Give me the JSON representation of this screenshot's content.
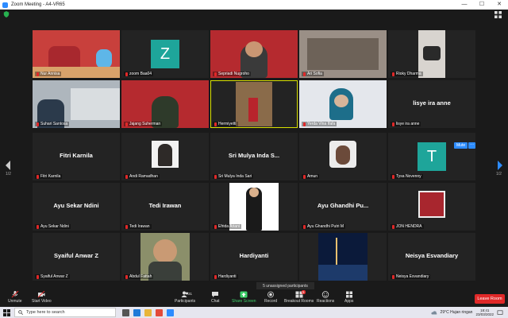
{
  "window": {
    "title": "Zoom Meeting - A4-VR65",
    "min": "—",
    "max": "☐",
    "close": "✕"
  },
  "pages": {
    "left": "1/2",
    "right": "1/2"
  },
  "tiles": [
    {
      "name": "Nur Annisa"
    },
    {
      "name": "zoom Baa04",
      "letter": "Z"
    },
    {
      "name": "Sepriadi Nugroho"
    },
    {
      "name": "Ari Sofia"
    },
    {
      "name": "Rioky Dharma"
    },
    {
      "name": "Suhari Santosa"
    },
    {
      "name": "Jajang Suherman"
    },
    {
      "name": "Hermiyetti"
    },
    {
      "name": "Yerda Vina Ifafa"
    },
    {
      "name": "lisye ira anne",
      "big": "lisye ira anne"
    },
    {
      "name": "Fitri Karnila",
      "big": "Fitri Karnila"
    },
    {
      "name": "Andi Ramadhan"
    },
    {
      "name": "Sri Mulya Inda Sari",
      "big": "Sri Mulya Inda S..."
    },
    {
      "name": "Amun"
    },
    {
      "name": "Tysa Novenny",
      "letter": "T"
    },
    {
      "name": "Ayu Sekar Ndini",
      "big": "Ayu Sekar Ndini"
    },
    {
      "name": "Tedi Irawan",
      "big": "Tedi Irawan"
    },
    {
      "name": "Efrida Ariani"
    },
    {
      "name": "Ayu Ghandhi Putri M",
      "big": "Ayu Ghandhi Pu..."
    },
    {
      "name": "JON HENDRA"
    },
    {
      "name": "Syaiful Anwar Z",
      "big": "Syaiful Anwar Z"
    },
    {
      "name": "Abdul Fattah"
    },
    {
      "name": "Hardiyanti",
      "big": "Hardiyanti"
    },
    {
      "name": ""
    },
    {
      "name": "Neisya Esvandiary",
      "big": "Neisya Esvandiary"
    }
  ],
  "mute_label": "Mute",
  "more_label": "···",
  "tooltip": "5 unassigned participants",
  "toolbar": {
    "unmute": "Unmute",
    "start_video": "Start Video",
    "participants": "Participants",
    "participants_count": "31",
    "chat": "Chat",
    "share": "Share Screen",
    "record": "Record",
    "breakout": "Breakout Rooms",
    "breakout_count": "5",
    "reactions": "Reactions",
    "apps": "Apps",
    "leave": "Leave Room"
  },
  "taskbar": {
    "search_placeholder": "Type here to search",
    "weather": "29°C  Hujan ringan",
    "time": "18:41",
    "date": "23/03/2022"
  },
  "colors": {
    "accent": "#2d8cff",
    "active_speaker": "#d8e000",
    "leave": "#e02828",
    "share": "#3ed06a"
  }
}
